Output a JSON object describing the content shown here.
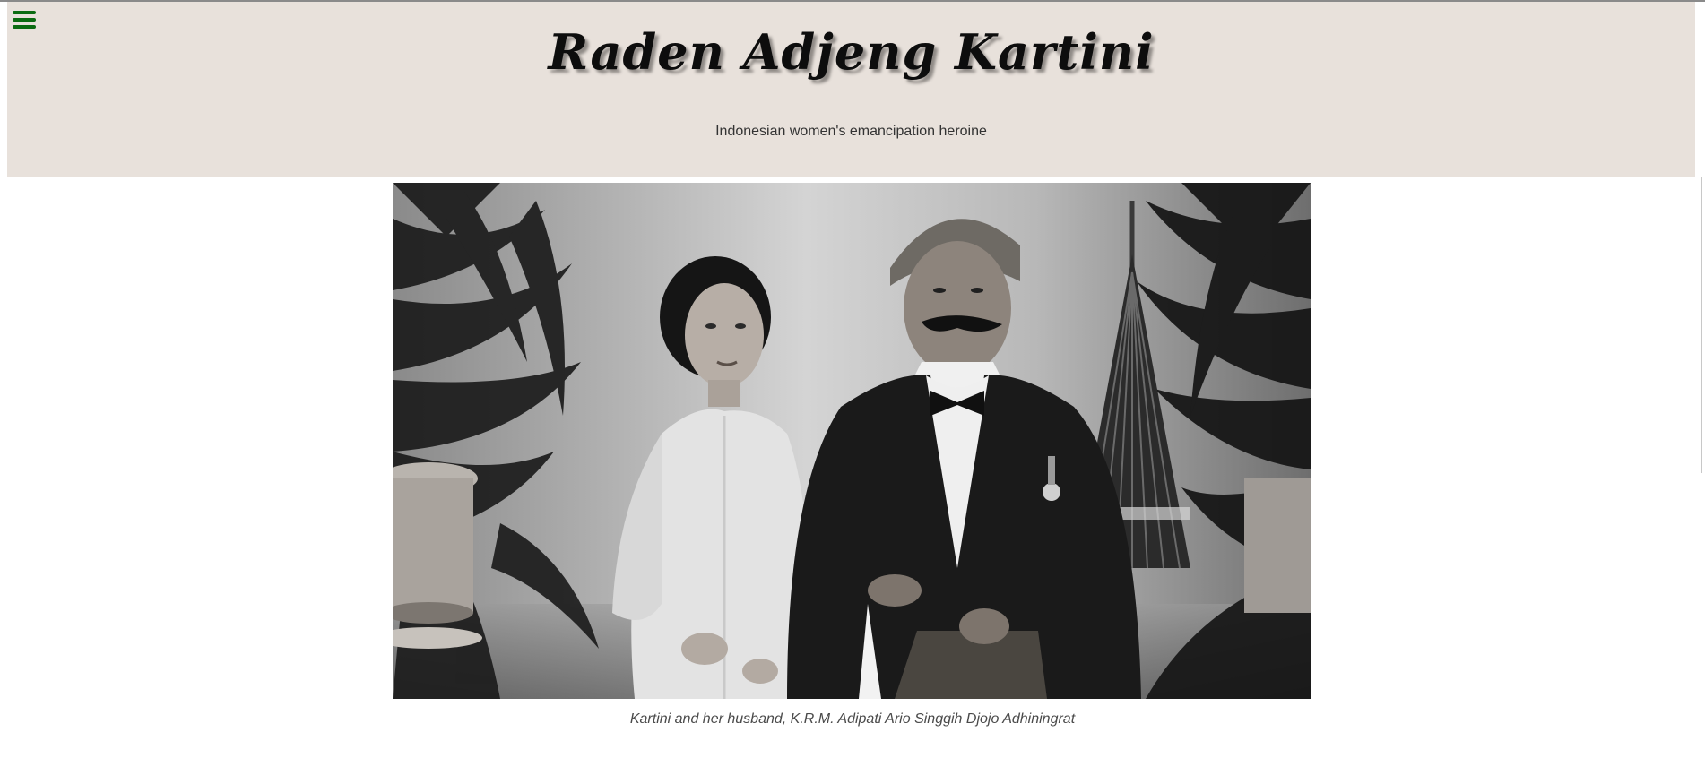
{
  "header": {
    "title": "Raden Adjeng Kartini",
    "subtitle": "Indonesian women's emancipation heroine"
  },
  "menu": {
    "icon": "hamburger-menu-icon"
  },
  "photo": {
    "caption": "Kartini and her husband, K.R.M. Adipati Ario Singgih Djojo Adhiningrat"
  },
  "colors": {
    "header_background": "#e8e1db",
    "menu_icon": "#0b6b12",
    "title_text": "#0d0d0d",
    "title_shadow": "#8f8a86"
  }
}
